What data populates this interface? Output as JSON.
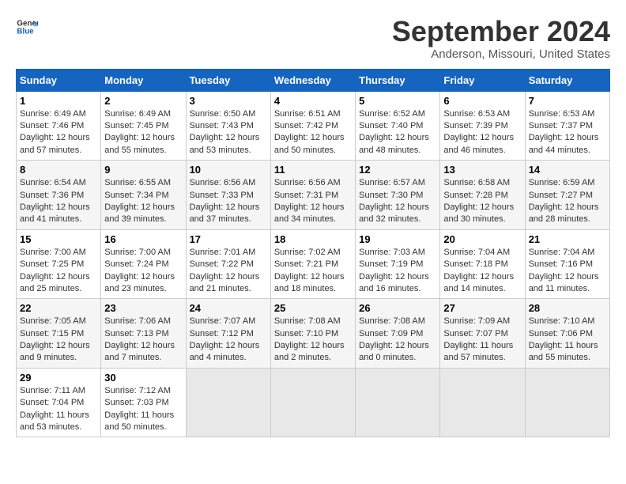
{
  "logo": {
    "line1": "General",
    "line2": "Blue"
  },
  "title": "September 2024",
  "subtitle": "Anderson, Missouri, United States",
  "headers": [
    "Sunday",
    "Monday",
    "Tuesday",
    "Wednesday",
    "Thursday",
    "Friday",
    "Saturday"
  ],
  "weeks": [
    [
      {
        "day": "1",
        "info": "Sunrise: 6:49 AM\nSunset: 7:46 PM\nDaylight: 12 hours\nand 57 minutes."
      },
      {
        "day": "2",
        "info": "Sunrise: 6:49 AM\nSunset: 7:45 PM\nDaylight: 12 hours\nand 55 minutes."
      },
      {
        "day": "3",
        "info": "Sunrise: 6:50 AM\nSunset: 7:43 PM\nDaylight: 12 hours\nand 53 minutes."
      },
      {
        "day": "4",
        "info": "Sunrise: 6:51 AM\nSunset: 7:42 PM\nDaylight: 12 hours\nand 50 minutes."
      },
      {
        "day": "5",
        "info": "Sunrise: 6:52 AM\nSunset: 7:40 PM\nDaylight: 12 hours\nand 48 minutes."
      },
      {
        "day": "6",
        "info": "Sunrise: 6:53 AM\nSunset: 7:39 PM\nDaylight: 12 hours\nand 46 minutes."
      },
      {
        "day": "7",
        "info": "Sunrise: 6:53 AM\nSunset: 7:37 PM\nDaylight: 12 hours\nand 44 minutes."
      }
    ],
    [
      {
        "day": "8",
        "info": "Sunrise: 6:54 AM\nSunset: 7:36 PM\nDaylight: 12 hours\nand 41 minutes."
      },
      {
        "day": "9",
        "info": "Sunrise: 6:55 AM\nSunset: 7:34 PM\nDaylight: 12 hours\nand 39 minutes."
      },
      {
        "day": "10",
        "info": "Sunrise: 6:56 AM\nSunset: 7:33 PM\nDaylight: 12 hours\nand 37 minutes."
      },
      {
        "day": "11",
        "info": "Sunrise: 6:56 AM\nSunset: 7:31 PM\nDaylight: 12 hours\nand 34 minutes."
      },
      {
        "day": "12",
        "info": "Sunrise: 6:57 AM\nSunset: 7:30 PM\nDaylight: 12 hours\nand 32 minutes."
      },
      {
        "day": "13",
        "info": "Sunrise: 6:58 AM\nSunset: 7:28 PM\nDaylight: 12 hours\nand 30 minutes."
      },
      {
        "day": "14",
        "info": "Sunrise: 6:59 AM\nSunset: 7:27 PM\nDaylight: 12 hours\nand 28 minutes."
      }
    ],
    [
      {
        "day": "15",
        "info": "Sunrise: 7:00 AM\nSunset: 7:25 PM\nDaylight: 12 hours\nand 25 minutes."
      },
      {
        "day": "16",
        "info": "Sunrise: 7:00 AM\nSunset: 7:24 PM\nDaylight: 12 hours\nand 23 minutes."
      },
      {
        "day": "17",
        "info": "Sunrise: 7:01 AM\nSunset: 7:22 PM\nDaylight: 12 hours\nand 21 minutes."
      },
      {
        "day": "18",
        "info": "Sunrise: 7:02 AM\nSunset: 7:21 PM\nDaylight: 12 hours\nand 18 minutes."
      },
      {
        "day": "19",
        "info": "Sunrise: 7:03 AM\nSunset: 7:19 PM\nDaylight: 12 hours\nand 16 minutes."
      },
      {
        "day": "20",
        "info": "Sunrise: 7:04 AM\nSunset: 7:18 PM\nDaylight: 12 hours\nand 14 minutes."
      },
      {
        "day": "21",
        "info": "Sunrise: 7:04 AM\nSunset: 7:16 PM\nDaylight: 12 hours\nand 11 minutes."
      }
    ],
    [
      {
        "day": "22",
        "info": "Sunrise: 7:05 AM\nSunset: 7:15 PM\nDaylight: 12 hours\nand 9 minutes."
      },
      {
        "day": "23",
        "info": "Sunrise: 7:06 AM\nSunset: 7:13 PM\nDaylight: 12 hours\nand 7 minutes."
      },
      {
        "day": "24",
        "info": "Sunrise: 7:07 AM\nSunset: 7:12 PM\nDaylight: 12 hours\nand 4 minutes."
      },
      {
        "day": "25",
        "info": "Sunrise: 7:08 AM\nSunset: 7:10 PM\nDaylight: 12 hours\nand 2 minutes."
      },
      {
        "day": "26",
        "info": "Sunrise: 7:08 AM\nSunset: 7:09 PM\nDaylight: 12 hours\nand 0 minutes."
      },
      {
        "day": "27",
        "info": "Sunrise: 7:09 AM\nSunset: 7:07 PM\nDaylight: 11 hours\nand 57 minutes."
      },
      {
        "day": "28",
        "info": "Sunrise: 7:10 AM\nSunset: 7:06 PM\nDaylight: 11 hours\nand 55 minutes."
      }
    ],
    [
      {
        "day": "29",
        "info": "Sunrise: 7:11 AM\nSunset: 7:04 PM\nDaylight: 11 hours\nand 53 minutes."
      },
      {
        "day": "30",
        "info": "Sunrise: 7:12 AM\nSunset: 7:03 PM\nDaylight: 11 hours\nand 50 minutes."
      },
      {
        "day": "",
        "info": ""
      },
      {
        "day": "",
        "info": ""
      },
      {
        "day": "",
        "info": ""
      },
      {
        "day": "",
        "info": ""
      },
      {
        "day": "",
        "info": ""
      }
    ]
  ]
}
